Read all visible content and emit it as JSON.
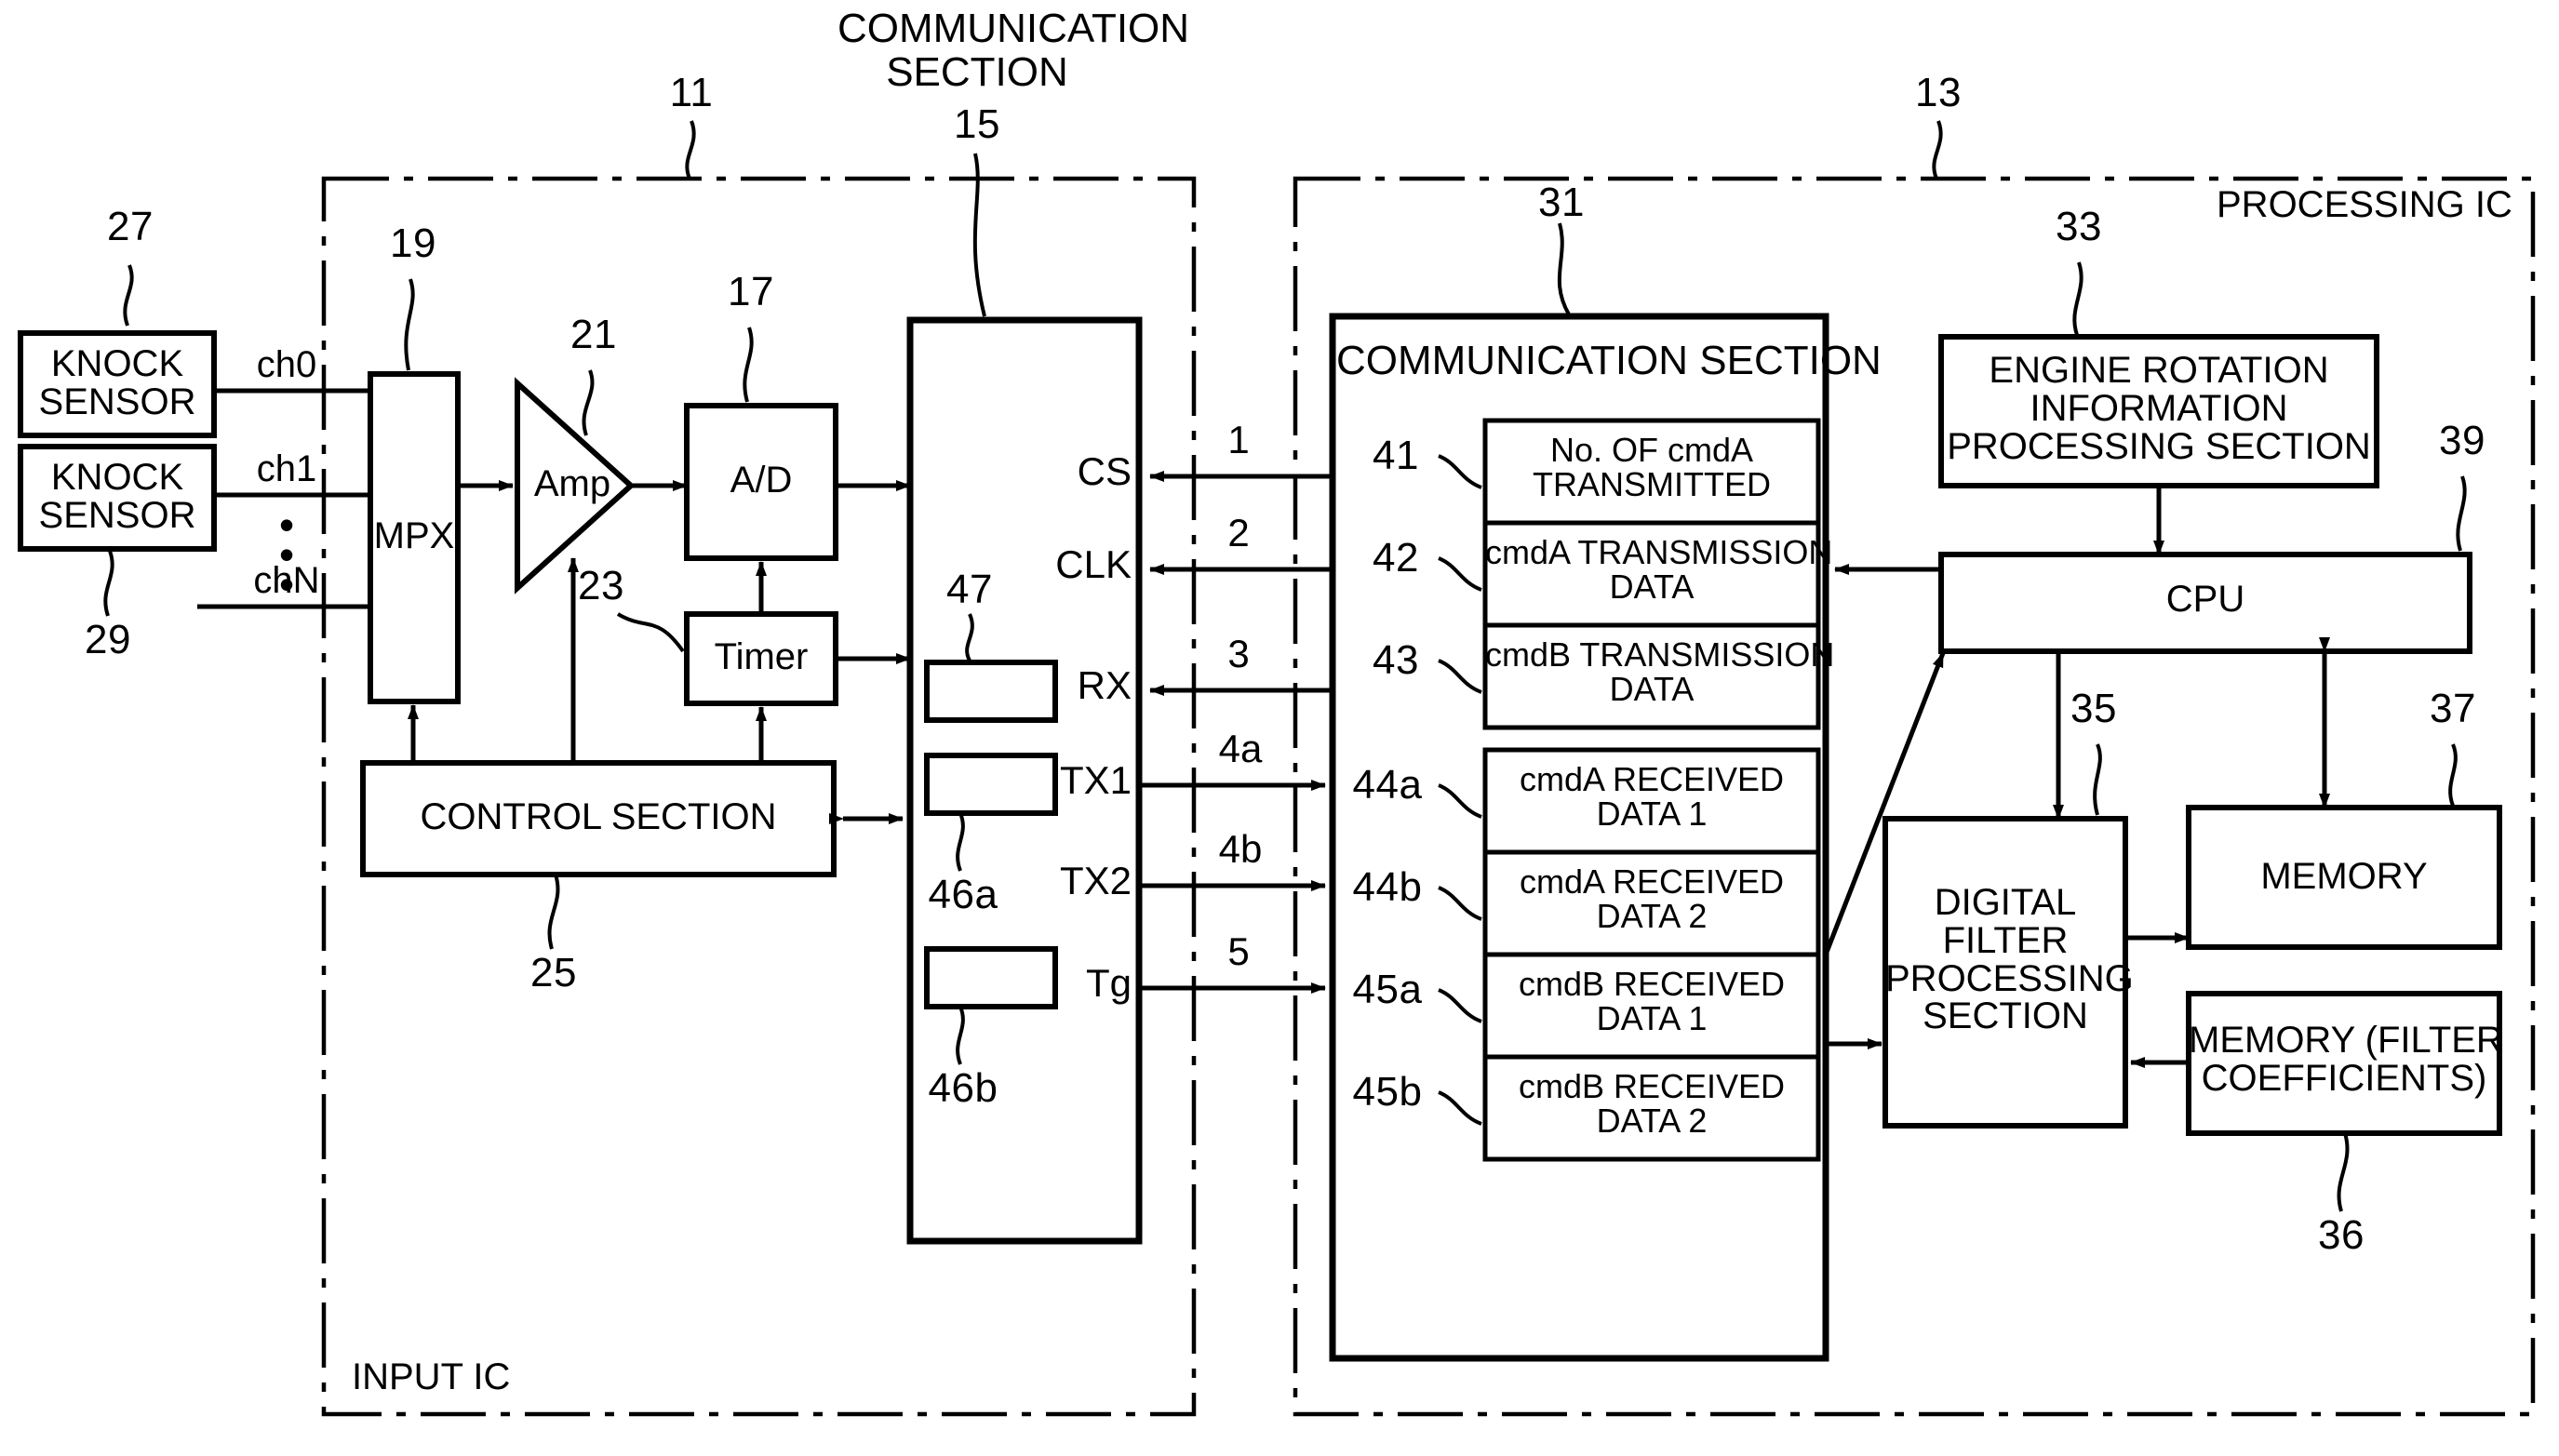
{
  "figure": {
    "title_top": "COMMUNICATION\nSECTION",
    "title_top_ref": "15"
  },
  "input_ic": {
    "boundary_label": "INPUT IC",
    "ref": "11",
    "blocks": {
      "mpx": {
        "label": "MPX",
        "ref": "19"
      },
      "amp": {
        "label": "Amp",
        "ref": "21"
      },
      "ad": {
        "label": "A/D",
        "ref": "17"
      },
      "timer": {
        "label": "Timer",
        "ref": "23"
      },
      "control": {
        "label": "CONTROL SECTION",
        "ref": "25"
      },
      "comm": {
        "ref": "15"
      }
    },
    "registers": [
      {
        "ref": "47"
      },
      {
        "ref": "46a"
      },
      {
        "ref": "46b"
      }
    ],
    "pins": [
      "CS",
      "CLK",
      "RX",
      "TX1",
      "TX2",
      "Tg"
    ]
  },
  "sensors": [
    {
      "label": "KNOCK\nSENSOR",
      "ref": "27"
    },
    {
      "label": "KNOCK\nSENSOR",
      "ref": "29"
    }
  ],
  "channels": [
    "ch0",
    "ch1",
    "chN"
  ],
  "channel_ellipsis": "•\n•\n•",
  "signals": [
    "1",
    "2",
    "3",
    "4a",
    "4b",
    "5"
  ],
  "processing_ic": {
    "boundary_label": "PROCESSING IC",
    "ref": "13",
    "communication_section": {
      "title": "COMMUNICATION SECTION",
      "ref": "31",
      "entries": [
        {
          "ref": "41",
          "label": "No. OF cmdA\nTRANSMITTED"
        },
        {
          "ref": "42",
          "label": "cmdA TRANSMISSION\nDATA"
        },
        {
          "ref": "43",
          "label": "cmdB TRANSMISSION\nDATA"
        },
        {
          "ref": "44a",
          "label": "cmdA RECEIVED\nDATA 1"
        },
        {
          "ref": "44b",
          "label": "cmdA RECEIVED\nDATA 2"
        },
        {
          "ref": "45a",
          "label": "cmdB RECEIVED\nDATA 1"
        },
        {
          "ref": "45b",
          "label": "cmdB RECEIVED\nDATA 2"
        }
      ]
    },
    "blocks": {
      "engine_rotation": {
        "label": "ENGINE ROTATION\nINFORMATION\nPROCESSING SECTION",
        "ref": "33"
      },
      "cpu": {
        "label": "CPU",
        "ref": "39"
      },
      "digital_filter": {
        "label": "DIGITAL\nFILTER\nPROCESSING\nSECTION",
        "ref": "35"
      },
      "memory": {
        "label": "MEMORY",
        "ref": "37"
      },
      "memory_filter": {
        "label": "MEMORY (FILTER\nCOEFFICIENTS)",
        "ref": "36"
      }
    }
  },
  "colors": {
    "stroke": "#000000",
    "background": "#ffffff"
  }
}
